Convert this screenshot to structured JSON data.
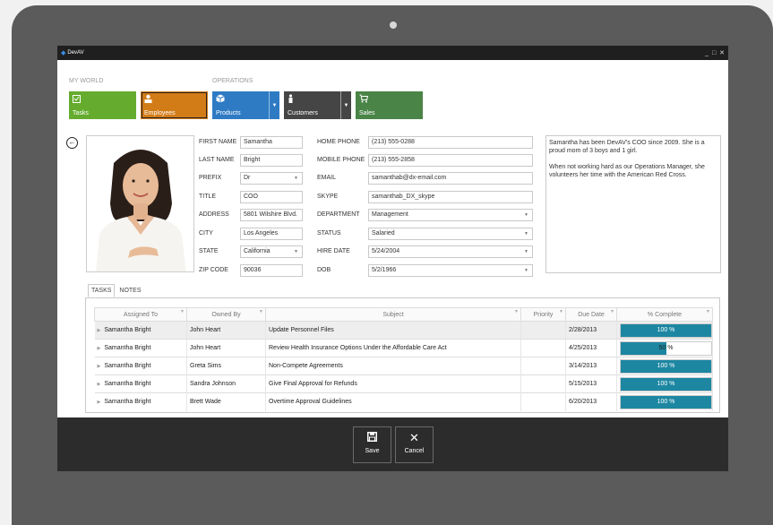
{
  "window": {
    "app_title": "DevAV",
    "controls": "_ □ ✕"
  },
  "nav": {
    "group_my_world": "MY WORLD",
    "group_operations": "OPERATIONS",
    "tiles": [
      {
        "label": "Tasks",
        "icon": "tasks-icon",
        "color": "#65ac2e"
      },
      {
        "label": "Employees",
        "icon": "person-icon",
        "color": "#d27c18"
      },
      {
        "label": "Products",
        "icon": "box-icon",
        "color": "#2e7bc4"
      },
      {
        "label": "Customers",
        "icon": "customer-icon",
        "color": "#454545"
      },
      {
        "label": "Sales",
        "icon": "cart-icon",
        "color": "#4a8447"
      }
    ]
  },
  "employee": {
    "first_name_label": "FIRST NAME",
    "first_name": "Samantha",
    "last_name_label": "LAST NAME",
    "last_name": "Bright",
    "prefix_label": "PREFIX",
    "prefix": "Dr",
    "title_label": "TITLE",
    "title": "COO",
    "address_label": "ADDRESS",
    "address": "5801 Wilshire Blvd.",
    "city_label": "CITY",
    "city": "Los Angeles",
    "state_label": "STATE",
    "state": "California",
    "zip_label": "ZIP CODE",
    "zip": "90036",
    "home_phone_label": "HOME PHONE",
    "home_phone": "(213) 555-0288",
    "mobile_phone_label": "MOBILE PHONE",
    "mobile_phone": "(213) 555-2858",
    "email_label": "EMAIL",
    "email": "samanthab@dx-email.com",
    "skype_label": "SKYPE",
    "skype": "samanthab_DX_skype",
    "department_label": "DEPARTMENT",
    "department": "Management",
    "status_label": "STATUS",
    "status": "Salaried",
    "hire_date_label": "HIRE DATE",
    "hire_date": "5/24/2004",
    "dob_label": "DOB",
    "dob": "5/2/1966",
    "bio_p1": "Samantha has been DevAV's COO since 2009. She is a proud mom of 3 boys and 1 girl.",
    "bio_p2": "When not working hard as our Operations Manager, she volunteers her time with the American Red Cross."
  },
  "tabs": {
    "tasks": "TASKS",
    "notes": "NOTES"
  },
  "grid": {
    "columns": [
      "Assigned To",
      "Owned By",
      "Subject",
      "Priority",
      "Due Date",
      "% Complete"
    ],
    "rows": [
      {
        "assigned": "Samantha Bright",
        "owner": "John Heart",
        "subject": "Update Personnel Files",
        "priority": "",
        "due": "2/28/2013",
        "pct": "100 %",
        "pct_value": 100
      },
      {
        "assigned": "Samantha Bright",
        "owner": "John Heart",
        "subject": "Review Health Insurance Options Under the Affordable Care Act",
        "priority": "",
        "due": "4/25/2013",
        "pct": "50 %",
        "pct_value": 50
      },
      {
        "assigned": "Samantha Bright",
        "owner": "Greta Sims",
        "subject": "Non-Compete Agreements",
        "priority": "",
        "due": "3/14/2013",
        "pct": "100 %",
        "pct_value": 100
      },
      {
        "assigned": "Samantha Bright",
        "owner": "Sandra Johnson",
        "subject": "Give Final Approval for Refunds",
        "priority": "",
        "due": "5/15/2013",
        "pct": "100 %",
        "pct_value": 100
      },
      {
        "assigned": "Samantha Bright",
        "owner": "Brett Wade",
        "subject": "Overtime Approval Guidelines",
        "priority": "",
        "due": "6/20/2013",
        "pct": "100 %",
        "pct_value": 100
      }
    ]
  },
  "actions": {
    "save": "Save",
    "cancel": "Cancel"
  },
  "colors": {
    "progress": "#1d87a2",
    "titlebar": "#1f1f1f",
    "bottombar": "#2c2c2c"
  }
}
